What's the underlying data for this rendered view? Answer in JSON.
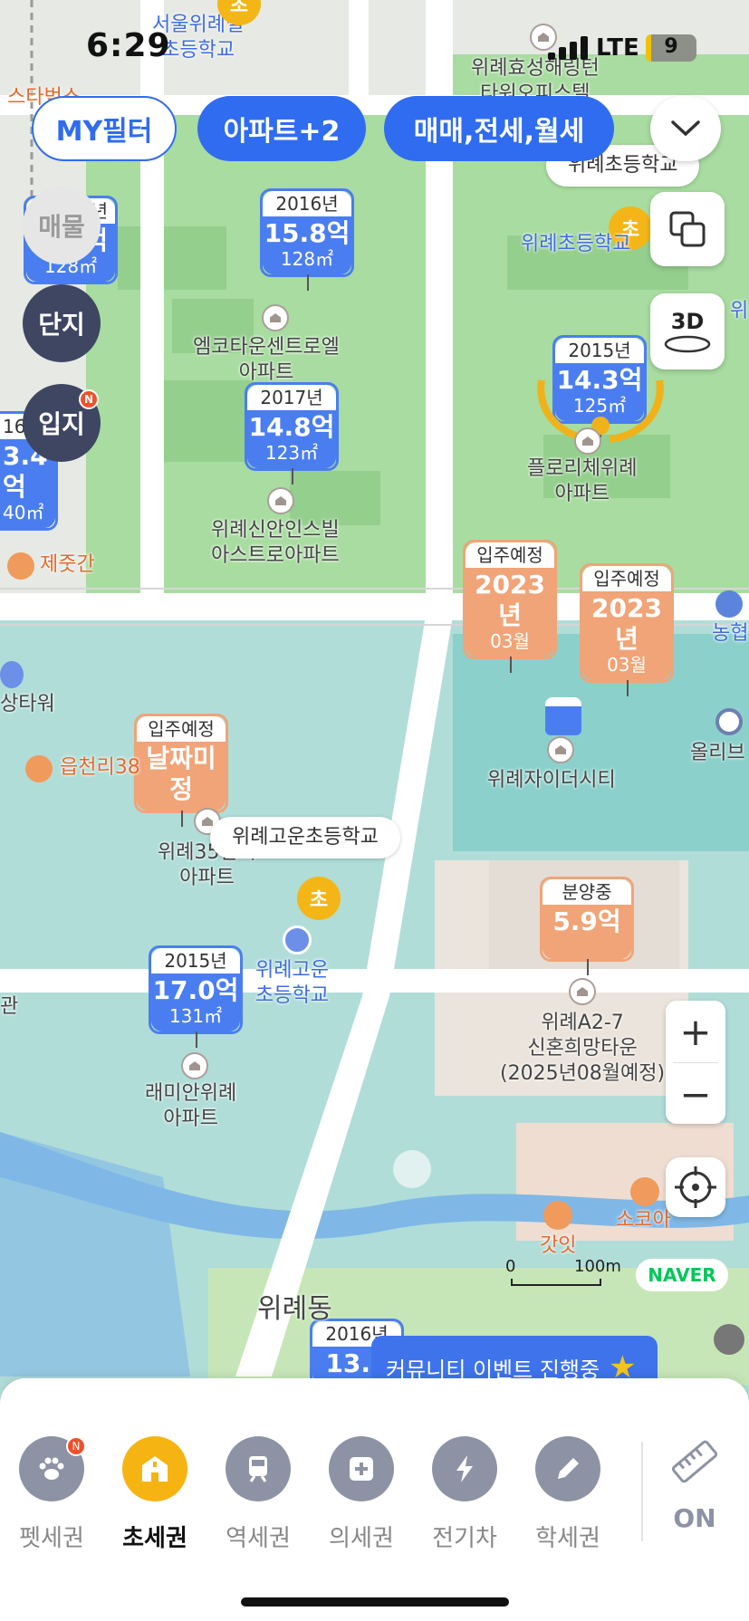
{
  "status_bar": {
    "time": "6:29",
    "network": "LTE",
    "battery": "9"
  },
  "filters": {
    "my_filter": "MY필터",
    "apartment": "아파트+2",
    "trade": "매매,전세,월세"
  },
  "side_buttons": {
    "listing": "매물",
    "complex": "단지",
    "location": "입지",
    "new_badge": "N"
  },
  "map_controls": {
    "view_3d": "3D"
  },
  "markers": [
    {
      "year": "2016년",
      "price": "15.8억",
      "area": "128㎡",
      "name": "엠코타운센트로엘\n아파트"
    },
    {
      "year": "2017년",
      "price": "14.8억",
      "area": "123㎡",
      "name": "위례신안인스빌\n아스트로아파트"
    },
    {
      "year": "2015년",
      "price": "14.3억",
      "area": "125㎡",
      "name": "플로리체위례\n아파트"
    },
    {
      "year": "입주예정",
      "price": "2023년",
      "area": "03월"
    },
    {
      "year": "입주예정",
      "price": "2023년",
      "area": "03월"
    },
    {
      "year": "입주예정",
      "price": "날짜미정",
      "area": "",
      "name": "위례35단지\n아파트"
    },
    {
      "year": "분양중",
      "price": "5.9억",
      "area": "",
      "name": "위례A2-7\n신혼희망타운\n(2025년08월예정)"
    },
    {
      "year": "2015년",
      "price": "17.0억",
      "area": "131㎡",
      "name": "래미안위례\n아파트"
    },
    {
      "year": "2016년",
      "price": "13.0",
      "area": ""
    },
    {
      "year": "16",
      "price": "3.4억",
      "area": "40㎡"
    },
    {
      "year": "년",
      "price": "억",
      "area": "128㎡"
    }
  ],
  "places": {
    "school_top": "서울위례별\n초등학교",
    "officetel": "위례효성해링턴\n타워오피스텔",
    "wirye_elem_bubble": "위례초등학교",
    "wirye_elem": "위례초등학교",
    "starbucks": "스타벅스",
    "jejutgan": "제줏간",
    "nonghyup": "농협",
    "tower": "상타워",
    "eupcheonri": "읍천리38",
    "oliveyoung": "올리브",
    "xi_city": "위례자이더시티",
    "gowun_bubble": "위례고운초등학교",
    "gowun_elem": "위례고운\n초등학교",
    "gwan": "관",
    "wirye_dong": "위례동",
    "gatit": "갓잇",
    "sokoa": "소코아",
    "school_glyph": "초",
    "map_edge": "위"
  },
  "scale": {
    "zero": "0",
    "distance": "100m"
  },
  "brand": "NAVER",
  "event_banner": "커뮤니티 이벤트 진행중",
  "categories": [
    {
      "label": "펫세권",
      "badge": "N",
      "icon": "paw-icon"
    },
    {
      "label": "초세권",
      "icon": "school-icon",
      "active": true
    },
    {
      "label": "역세권",
      "icon": "train-icon"
    },
    {
      "label": "의세권",
      "icon": "medical-icon"
    },
    {
      "label": "전기차",
      "icon": "lightning-icon"
    },
    {
      "label": "학세권",
      "icon": "pencil-icon"
    }
  ],
  "ruler_toggle": "ON",
  "colors": {
    "accent": "#2f6cf0",
    "school": "#f4b616",
    "sale": "#f0a478",
    "price": "#4a7ef0"
  }
}
